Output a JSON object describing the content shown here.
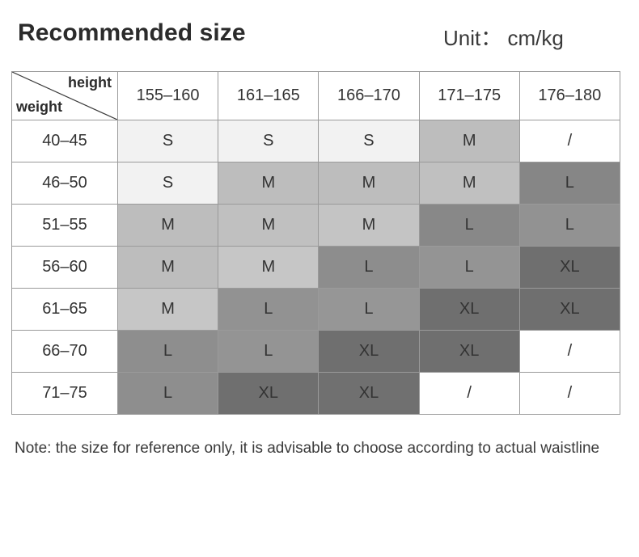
{
  "header": {
    "title": "Recommended size",
    "unit": "Unit： cm/kg"
  },
  "table": {
    "corner": {
      "height_label": "height",
      "weight_label": "weight"
    },
    "columns": [
      "155–160",
      "161–165",
      "166–170",
      "171–175",
      "176–180"
    ],
    "rows": [
      {
        "label": "40–45",
        "cells": [
          {
            "value": "S",
            "bg": "#f2f2f2"
          },
          {
            "value": "S",
            "bg": "#f2f2f2"
          },
          {
            "value": "S",
            "bg": "#f2f2f2"
          },
          {
            "value": "M",
            "bg": "#bdbdbd"
          },
          {
            "value": "/",
            "bg": "#ffffff"
          }
        ]
      },
      {
        "label": "46–50",
        "cells": [
          {
            "value": "S",
            "bg": "#f2f2f2"
          },
          {
            "value": "M",
            "bg": "#bdbdbd"
          },
          {
            "value": "M",
            "bg": "#bdbdbd"
          },
          {
            "value": "M",
            "bg": "#c0c0c0"
          },
          {
            "value": "L",
            "bg": "#868686"
          }
        ]
      },
      {
        "label": "51–55",
        "cells": [
          {
            "value": "M",
            "bg": "#bdbdbd"
          },
          {
            "value": "M",
            "bg": "#c0c0c0"
          },
          {
            "value": "M",
            "bg": "#c4c4c4"
          },
          {
            "value": "L",
            "bg": "#888888"
          },
          {
            "value": "L",
            "bg": "#929292"
          }
        ]
      },
      {
        "label": "56–60",
        "cells": [
          {
            "value": "M",
            "bg": "#bdbdbd"
          },
          {
            "value": "M",
            "bg": "#c6c6c6"
          },
          {
            "value": "L",
            "bg": "#8d8d8d"
          },
          {
            "value": "L",
            "bg": "#949494"
          },
          {
            "value": "XL",
            "bg": "#6f6f6f"
          }
        ]
      },
      {
        "label": "61–65",
        "cells": [
          {
            "value": "M",
            "bg": "#c6c6c6"
          },
          {
            "value": "L",
            "bg": "#929292"
          },
          {
            "value": "L",
            "bg": "#969696"
          },
          {
            "value": "XL",
            "bg": "#6f6f6f"
          },
          {
            "value": "XL",
            "bg": "#6f6f6f"
          }
        ]
      },
      {
        "label": "66–70",
        "cells": [
          {
            "value": "L",
            "bg": "#8e8e8e"
          },
          {
            "value": "L",
            "bg": "#949494"
          },
          {
            "value": "XL",
            "bg": "#6f6f6f"
          },
          {
            "value": "XL",
            "bg": "#6f6f6f"
          },
          {
            "value": "/",
            "bg": "#ffffff"
          }
        ]
      },
      {
        "label": "71–75",
        "cells": [
          {
            "value": "L",
            "bg": "#8e8e8e"
          },
          {
            "value": "XL",
            "bg": "#6f6f6f"
          },
          {
            "value": "XL",
            "bg": "#707070"
          },
          {
            "value": "/",
            "bg": "#ffffff"
          },
          {
            "value": "/",
            "bg": "#ffffff"
          }
        ]
      }
    ]
  },
  "note": {
    "text": "Note: the size for reference only, it is advisable to choose according to actual waistline"
  },
  "colors": {
    "border": "#9a9a9a",
    "text": "#333333",
    "title": "#2b2b2b",
    "background": "#ffffff"
  }
}
